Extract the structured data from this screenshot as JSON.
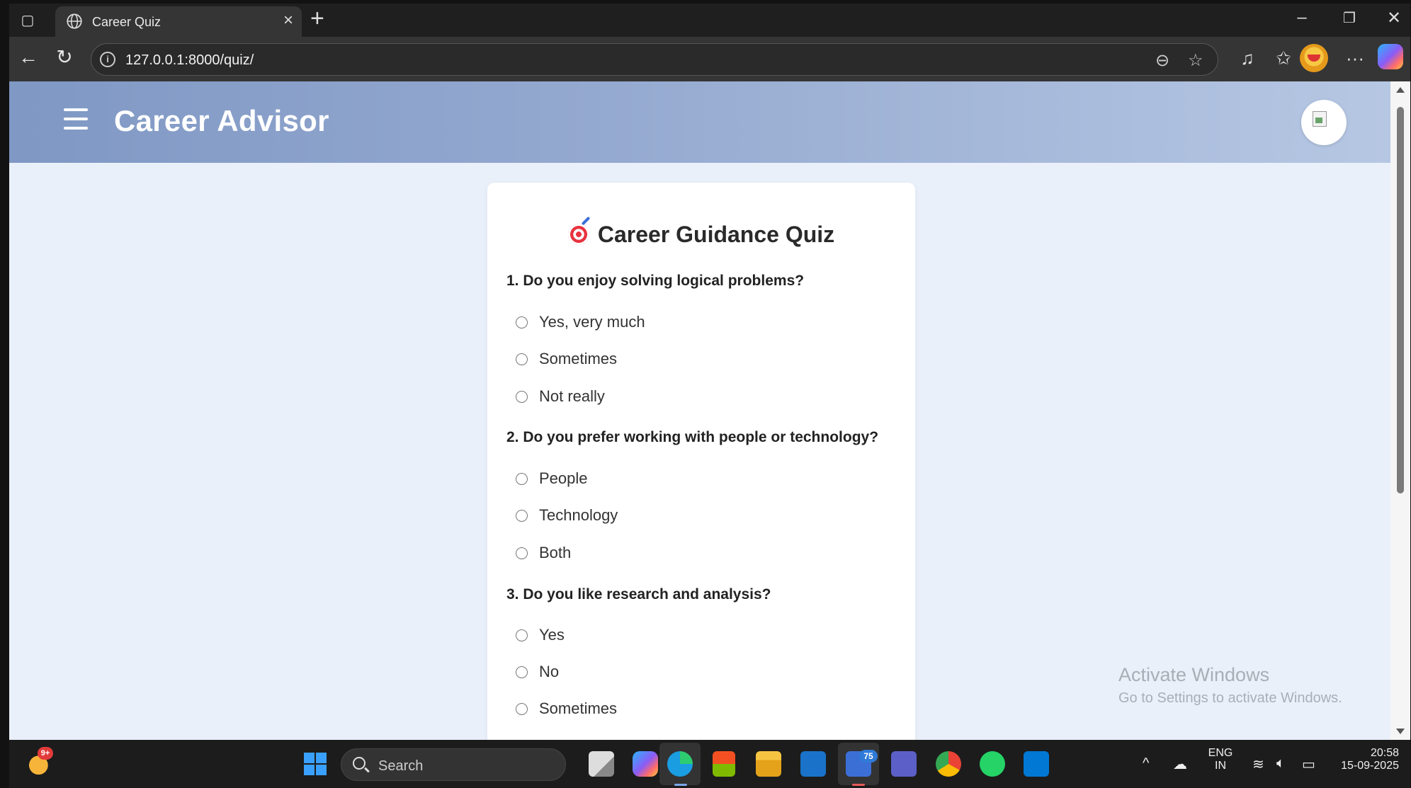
{
  "browser": {
    "tab_title": "Career Quiz",
    "url": "127.0.0.1:8000/quiz/"
  },
  "header": {
    "brand": "Career Advisor"
  },
  "quiz": {
    "title": "Career Guidance Quiz",
    "questions": [
      {
        "text": "1. Do you enjoy solving logical problems?",
        "options": [
          "Yes, very much",
          "Sometimes",
          "Not really"
        ]
      },
      {
        "text": "2. Do you prefer working with people or technology?",
        "options": [
          "People",
          "Technology",
          "Both"
        ]
      },
      {
        "text": "3. Do you like research and analysis?",
        "options": [
          "Yes",
          "No",
          "Sometimes"
        ]
      }
    ]
  },
  "watermark": {
    "line1": "Activate Windows",
    "line2": "Go to Settings to activate Windows."
  },
  "taskbar": {
    "weather_badge": "9+",
    "search_label": "Search",
    "outlook_badge": "75",
    "lang_line1": "ENG",
    "lang_line2": "IN",
    "time": "20:58",
    "date": "15-09-2025"
  },
  "colors": {
    "header_start": "#7f98c4",
    "header_end": "#b6c7e3",
    "page_bg": "#eaf0fa",
    "card_bg": "#ffffff"
  }
}
